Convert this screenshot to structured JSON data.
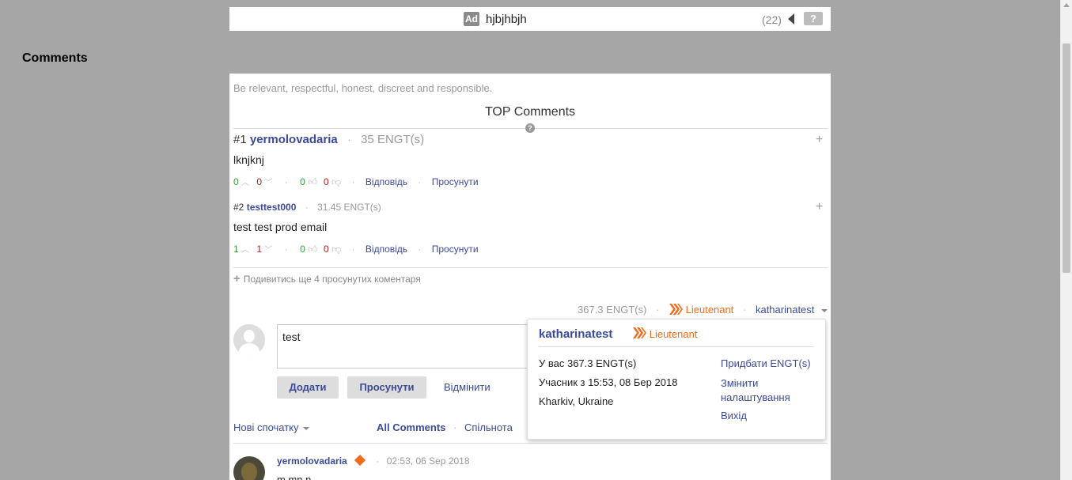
{
  "ad": {
    "badge": "Ad",
    "text": "hjbjhbjh",
    "count": "(22)",
    "help": "?"
  },
  "comments_heading": "Comments",
  "panel": {
    "rules": "Be relevant, respectful, honest, discreet and responsible.",
    "top_title": "TOP Comments",
    "top_help": "?",
    "top_comments": [
      {
        "rank": "#1",
        "author": "yermolovadaria",
        "engt": "35 ENGT(s)",
        "text": "lknjknj",
        "up": "0",
        "down": "0",
        "likes": "0",
        "dislikes": "0",
        "reply": "Відповідь",
        "promote": "Просунути"
      },
      {
        "rank": "#2",
        "author": "testtest000",
        "engt": "31.45 ENGT(s)",
        "text": "test test prod email",
        "up": "1",
        "down": "1",
        "likes": "0",
        "dislikes": "0",
        "reply": "Відповідь",
        "promote": "Просунути"
      }
    ],
    "see_more": "Подивитись ще 4 просунутих коментаря",
    "user_engt": "367.3 ENGT(s)",
    "user_rank": "Lieutenant",
    "username": "katharinatest",
    "composer_text": "test",
    "add_button": "Додати",
    "promote_button": "Просунути",
    "cancel_button": "Відмінити",
    "sort_label": "Нові спочатку",
    "filter_all": "All Comments",
    "filter_community": "Спільнота",
    "comment": {
      "author": "yermolovadaria",
      "time": "02:53, 06 Sep 2018",
      "text": "m mn n"
    }
  },
  "popup": {
    "username": "katharinatest",
    "rank": "Lieutenant",
    "balance": "У вас 367.3 ENGT(s)",
    "member_since": "Учасник з 15:53, 08 Бер 2018",
    "location": "Kharkiv, Ukraine",
    "buy": "Придбати ENGT(s)",
    "settings": "Змінити налаштування",
    "logout": "Вихід"
  },
  "colors": {
    "accent": "#3b4a9a",
    "orange": "#f26b1a",
    "backdrop": "#a6a6a6"
  }
}
